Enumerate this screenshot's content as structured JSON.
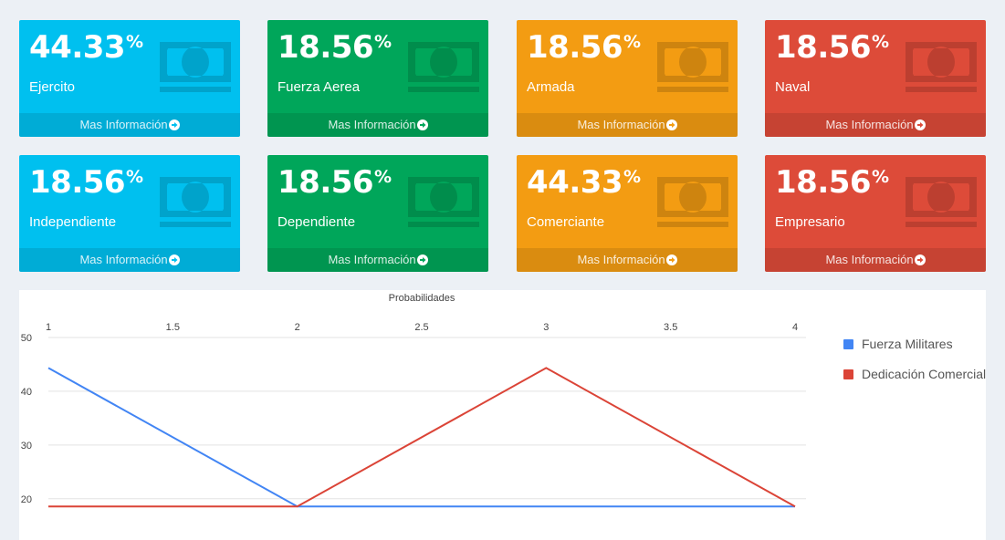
{
  "colors": {
    "aqua": "#00c0ef",
    "green": "#00a65a",
    "yellow": "#f39c12",
    "red": "#dd4b39",
    "series_blue": "#4285f4",
    "series_red": "#db4437"
  },
  "stat_boxes": [
    {
      "value": "44.33",
      "unit": "%",
      "label": "Ejercito",
      "link": "Mas Información",
      "color": "aqua",
      "icon": "money-icon"
    },
    {
      "value": "18.56",
      "unit": "%",
      "label": "Fuerza Aerea",
      "link": "Mas Información",
      "color": "green",
      "icon": "money-icon"
    },
    {
      "value": "18.56",
      "unit": "%",
      "label": "Armada",
      "link": "Mas Información",
      "color": "yellow",
      "icon": "money-icon"
    },
    {
      "value": "18.56",
      "unit": "%",
      "label": "Naval",
      "link": "Mas Información",
      "color": "red",
      "icon": "money-icon"
    },
    {
      "value": "18.56",
      "unit": "%",
      "label": "Independiente",
      "link": "Mas Información",
      "color": "aqua",
      "icon": "money-icon"
    },
    {
      "value": "18.56",
      "unit": "%",
      "label": "Dependiente",
      "link": "Mas Información",
      "color": "green",
      "icon": "money-icon"
    },
    {
      "value": "44.33",
      "unit": "%",
      "label": "Comerciante",
      "link": "Mas Información",
      "color": "yellow",
      "icon": "money-icon"
    },
    {
      "value": "18.56",
      "unit": "%",
      "label": "Empresario",
      "link": "Mas Información",
      "color": "red",
      "icon": "money-icon"
    }
  ],
  "chart_data": {
    "type": "line",
    "title": "Probabilidades",
    "xlabel": "",
    "ylabel": "",
    "x": [
      1,
      2,
      3,
      4
    ],
    "xticks": [
      "1",
      "1.5",
      "2",
      "2.5",
      "3",
      "3.5",
      "4"
    ],
    "xlim": [
      1,
      4
    ],
    "yticks": [
      "50",
      "40",
      "30",
      "20"
    ],
    "ylim": [
      20,
      50
    ],
    "x_axis_position": "top",
    "grid": true,
    "legend_position": "right",
    "series": [
      {
        "name": "Fuerza Militares",
        "values": [
          44.33,
          18.56,
          18.56,
          18.56
        ],
        "color": "#4285f4"
      },
      {
        "name": "Dedicación Comercial",
        "values": [
          18.56,
          18.56,
          44.33,
          18.56
        ],
        "color": "#db4437"
      }
    ]
  }
}
